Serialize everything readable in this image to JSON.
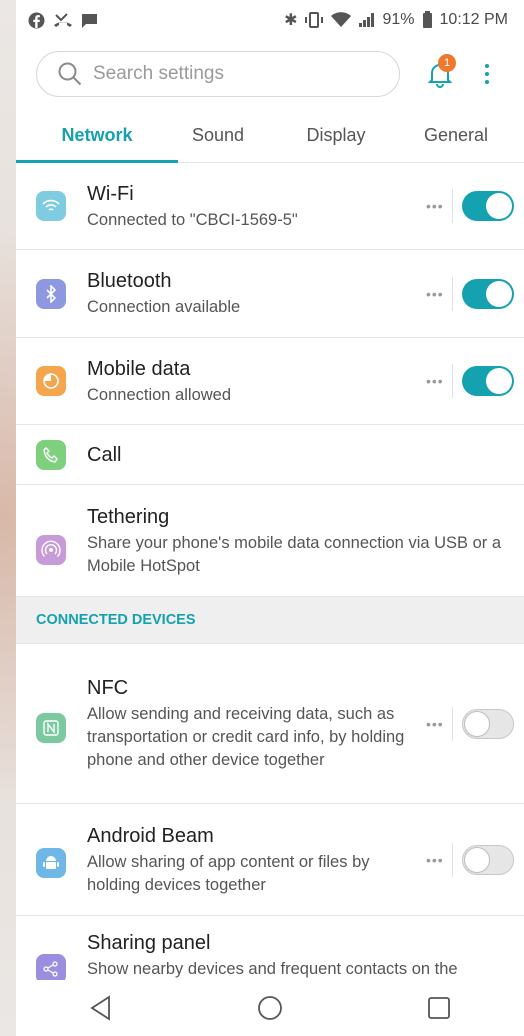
{
  "status_bar": {
    "battery": "91%",
    "time": "10:12 PM"
  },
  "search": {
    "placeholder": "Search settings",
    "notification_count": "1"
  },
  "tabs": [
    {
      "label": "Network",
      "active": true
    },
    {
      "label": "Sound",
      "active": false
    },
    {
      "label": "Display",
      "active": false
    },
    {
      "label": "General",
      "active": false
    }
  ],
  "network_items": [
    {
      "title": "Wi-Fi",
      "subtitle": "Connected to \"CBCI-1569-5\"",
      "icon": "wifi-icon",
      "color": "#7fcbe0",
      "toggle": "on"
    },
    {
      "title": "Bluetooth",
      "subtitle": "Connection available",
      "icon": "bluetooth-icon",
      "color": "#8d98e0",
      "toggle": "on"
    },
    {
      "title": "Mobile data",
      "subtitle": "Connection allowed",
      "icon": "mobile-data-icon",
      "color": "#f5a64c",
      "toggle": "on"
    },
    {
      "title": "Call",
      "subtitle": "",
      "icon": "call-icon",
      "color": "#7ed07e"
    },
    {
      "title": "Tethering",
      "subtitle": "Share your phone's mobile data connection via USB or a Mobile HotSpot",
      "icon": "tethering-icon",
      "color": "#c79ad8"
    }
  ],
  "connected_devices": {
    "header": "CONNECTED DEVICES",
    "items": [
      {
        "title": "NFC",
        "subtitle": "Allow sending and receiving data, such as transportation or credit card info, by holding phone and other device together",
        "icon": "nfc-icon",
        "color": "#7cc8a0",
        "toggle": "off"
      },
      {
        "title": "Android Beam",
        "subtitle": "Allow sharing of app content or files by holding devices together",
        "icon": "android-icon",
        "color": "#6fb7e6",
        "toggle": "off"
      },
      {
        "title": "Sharing panel",
        "subtitle": "Show nearby devices and frequent contacts on the",
        "icon": "share-icon",
        "color": "#9b8de0"
      }
    ]
  },
  "colors": {
    "accent": "#14a1b0",
    "badge": "#f0782c"
  }
}
